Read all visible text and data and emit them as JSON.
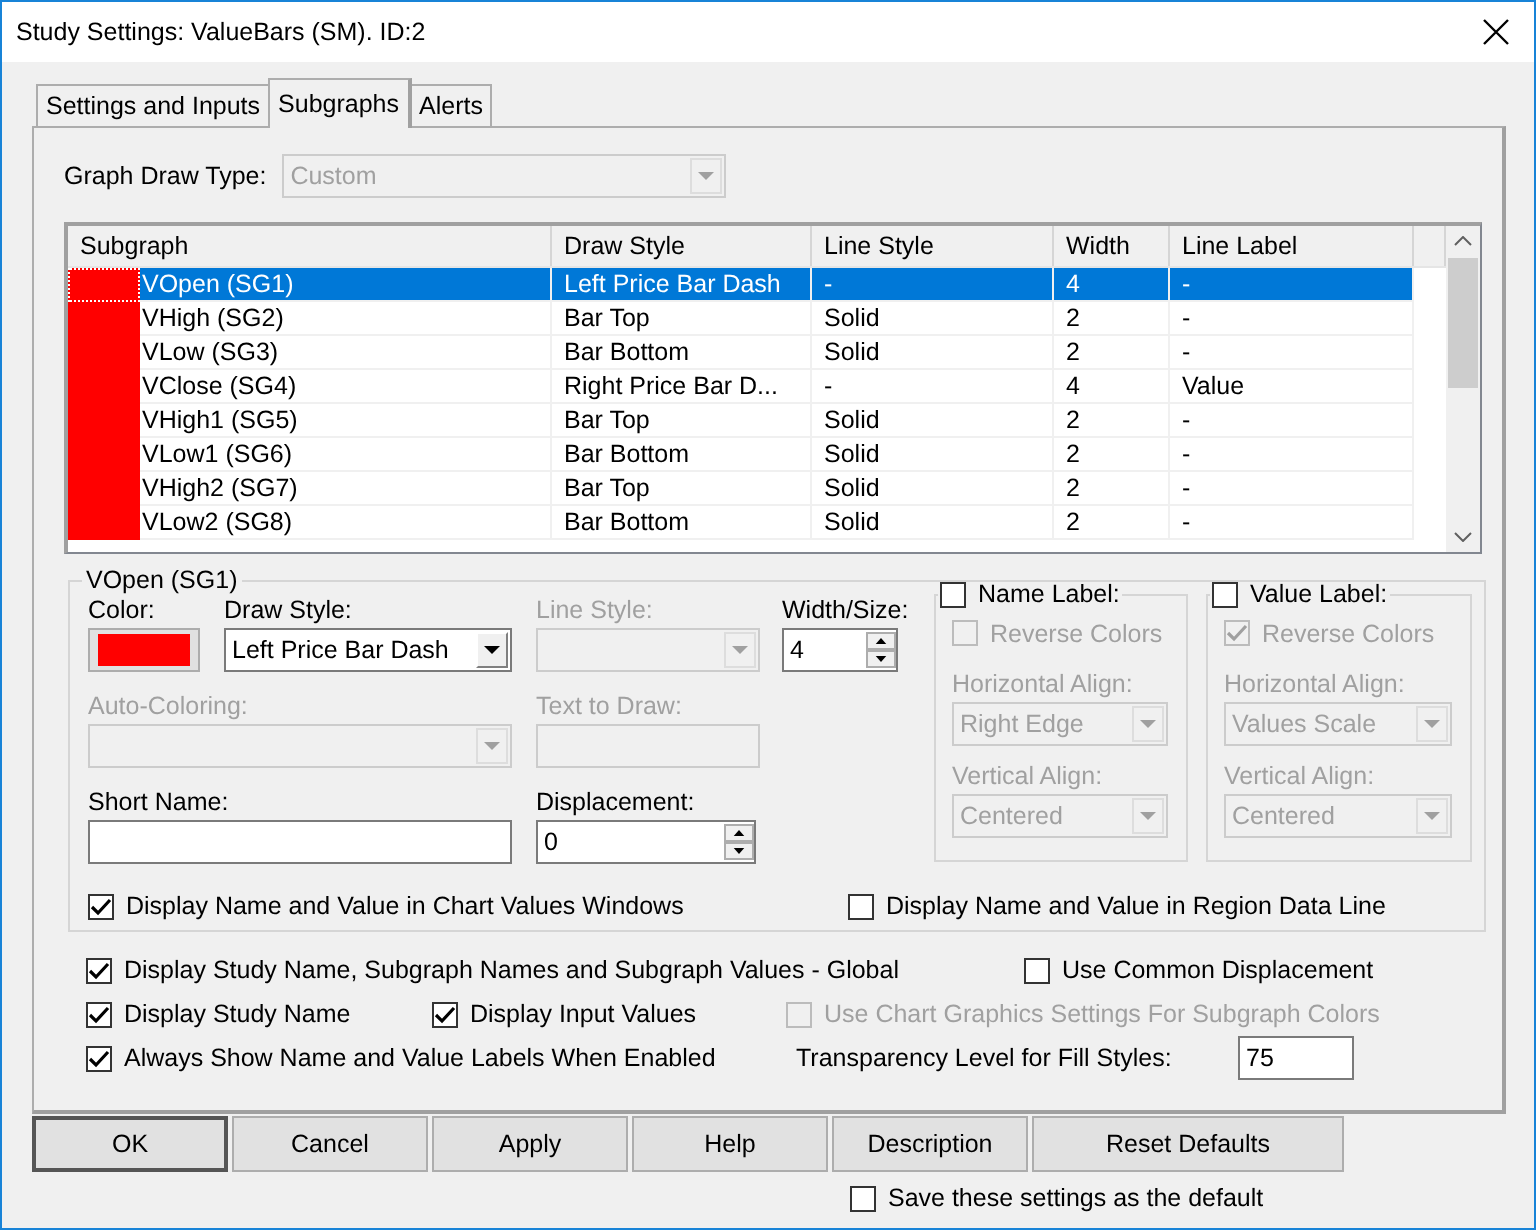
{
  "window": {
    "title": "Study Settings: ValueBars (SM). ID:2"
  },
  "tabs": [
    {
      "label": "Settings and Inputs",
      "selected": false
    },
    {
      "label": "Subgraphs",
      "selected": true
    },
    {
      "label": "Alerts",
      "selected": false
    }
  ],
  "graph_draw_type": {
    "label": "Graph Draw Type:",
    "value": "Custom",
    "disabled": true
  },
  "table": {
    "columns": [
      "Subgraph",
      "Draw Style",
      "Line Style",
      "Width",
      "Line Label"
    ],
    "rows": [
      {
        "color": "#ff0000",
        "cells": [
          "VOpen (SG1)",
          "Left Price Bar Dash",
          "-",
          "4",
          "-"
        ],
        "selected": true
      },
      {
        "color": "#ff0000",
        "cells": [
          "VHigh (SG2)",
          "Bar Top",
          "Solid",
          "2",
          "-"
        ],
        "selected": false
      },
      {
        "color": "#ff0000",
        "cells": [
          "VLow (SG3)",
          "Bar Bottom",
          "Solid",
          "2",
          "-"
        ],
        "selected": false
      },
      {
        "color": "#ff0000",
        "cells": [
          "VClose (SG4)",
          "Right Price Bar D...",
          "-",
          "4",
          "Value"
        ],
        "selected": false
      },
      {
        "color": "#ff0000",
        "cells": [
          "VHigh1 (SG5)",
          "Bar Top",
          "Solid",
          "2",
          "-"
        ],
        "selected": false
      },
      {
        "color": "#ff0000",
        "cells": [
          "VLow1 (SG6)",
          "Bar Bottom",
          "Solid",
          "2",
          "-"
        ],
        "selected": false
      },
      {
        "color": "#ff0000",
        "cells": [
          "VHigh2 (SG7)",
          "Bar Top",
          "Solid",
          "2",
          "-"
        ],
        "selected": false
      },
      {
        "color": "#ff0000",
        "cells": [
          "VLow2 (SG8)",
          "Bar Bottom",
          "Solid",
          "2",
          "-"
        ],
        "selected": false
      }
    ]
  },
  "subgraph_group": {
    "title": "VOpen (SG1)",
    "color": {
      "label": "Color:",
      "color": "#ff0000"
    },
    "draw_style": {
      "kind": "select",
      "label": "Draw Style:",
      "value": "Left Price Bar Dash",
      "disabled": false
    },
    "auto_coloring": {
      "kind": "select",
      "label": "Auto-Coloring:",
      "disabled": true
    },
    "short_name": {
      "kind": "text",
      "label": "Short Name:",
      "disabled": false
    },
    "line_style": {
      "kind": "select",
      "label": "Line Style:",
      "disabled": true
    },
    "text_to_draw": {
      "kind": "text",
      "label": "Text to Draw:",
      "disabled": true
    },
    "displacement": {
      "kind": "spinner",
      "label": "Displacement:",
      "value": "0",
      "disabled": false
    },
    "width_size": {
      "kind": "spinner",
      "label": "Width/Size:",
      "value": "4",
      "disabled": false
    },
    "label_groups": [
      {
        "label": "Name Label:",
        "checked": false,
        "reverse_colors": {
          "label": "Reverse Colors",
          "checked": false,
          "disabled": true
        },
        "fields": [
          {
            "kind": "select",
            "label": "Horizontal Align:",
            "value": "Right Edge",
            "disabled": true
          },
          {
            "kind": "select",
            "label": "Vertical Align:",
            "value": "Centered",
            "disabled": true
          }
        ]
      },
      {
        "label": "Value Label:",
        "checked": false,
        "reverse_colors": {
          "label": "Reverse Colors",
          "checked": true,
          "disabled": true
        },
        "fields": [
          {
            "kind": "select",
            "label": "Horizontal Align:",
            "value": "Values Scale",
            "disabled": true
          },
          {
            "kind": "select",
            "label": "Vertical Align:",
            "value": "Centered",
            "disabled": true
          }
        ]
      }
    ],
    "checkboxes": [
      {
        "label": "Display Name and Value in Chart Values Windows",
        "checked": true,
        "disabled": false
      },
      {
        "label": "Display Name and Value in Region Data Line",
        "checked": false,
        "disabled": false
      }
    ]
  },
  "global_options": [
    [
      {
        "kind": "checkbox",
        "label": "Display Study Name, Subgraph Names and Subgraph Values - Global",
        "checked": true,
        "disabled": false
      },
      {
        "kind": "checkbox",
        "label": "Use Common Displacement",
        "checked": false,
        "disabled": false
      }
    ],
    [
      {
        "kind": "checkbox",
        "label": "Display Study Name",
        "checked": true,
        "disabled": false
      },
      {
        "kind": "checkbox",
        "label": "Display Input Values",
        "checked": true,
        "disabled": false
      },
      {
        "kind": "checkbox",
        "label": "Use Chart Graphics Settings For Subgraph Colors",
        "checked": false,
        "disabled": true
      }
    ],
    [
      {
        "kind": "checkbox",
        "label": "Always Show Name and Value Labels When Enabled",
        "checked": true,
        "disabled": false
      },
      {
        "kind": "field",
        "label": "Transparency Level for Fill Styles:",
        "value": "75"
      }
    ]
  ],
  "buttons": [
    {
      "label": "OK",
      "default": true
    },
    {
      "label": "Cancel",
      "default": false
    },
    {
      "label": "Apply",
      "default": false
    },
    {
      "label": "Help",
      "default": false
    },
    {
      "label": "Description",
      "default": false
    },
    {
      "label": "Reset Defaults",
      "default": false
    }
  ],
  "save_default": {
    "label": "Save these settings as the default",
    "checked": false
  }
}
